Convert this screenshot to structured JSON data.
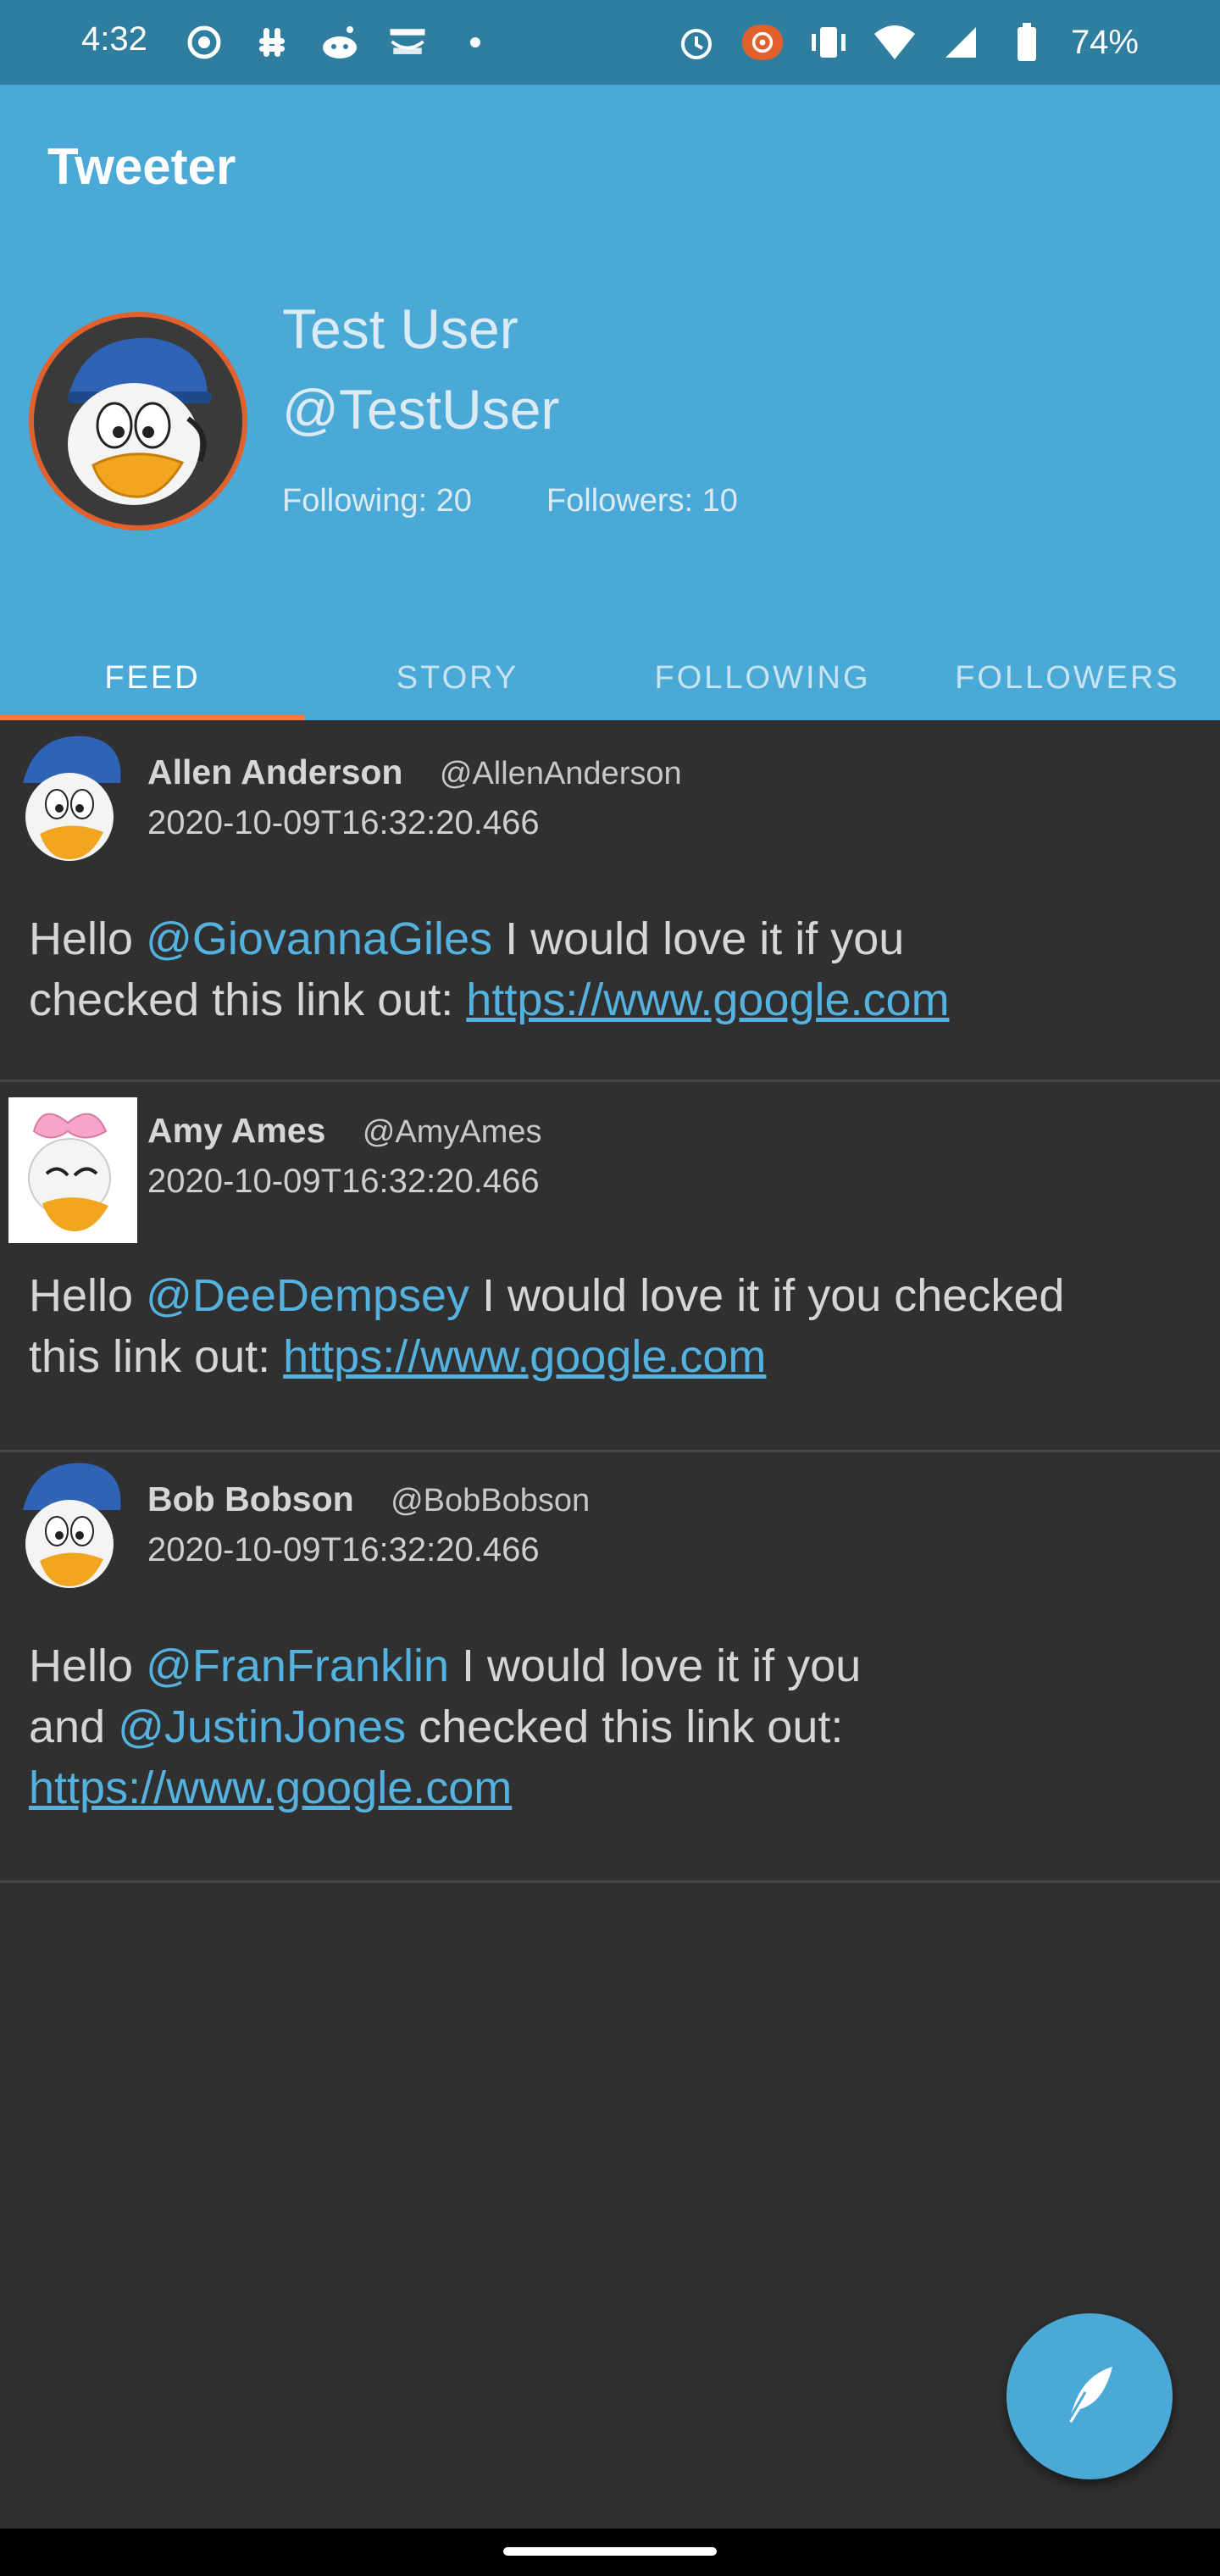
{
  "status_bar": {
    "time": "4:32",
    "battery": "74%",
    "left_icons": [
      "record-icon",
      "slack-icon",
      "reddit-icon",
      "amazon-icon",
      "dot-icon"
    ],
    "right_icons": [
      "alarm-icon",
      "cast-icon",
      "vibrate-icon",
      "wifi-icon",
      "signal-icon",
      "battery-icon"
    ]
  },
  "app": {
    "title": "Tweeter",
    "accent_color": "#4aa9d6",
    "tab_indicator_color": "#f07a4c"
  },
  "profile": {
    "name": "Test User",
    "handle": "@TestUser",
    "following": "Following: 20",
    "followers": "Followers: 10"
  },
  "tabs": [
    {
      "label": "FEED",
      "active": true
    },
    {
      "label": "STORY",
      "active": false
    },
    {
      "label": "FOLLOWING",
      "active": false
    },
    {
      "label": "FOLLOWERS",
      "active": false
    }
  ],
  "posts": [
    {
      "name": "Allen Anderson",
      "handle": "@AllenAnderson",
      "timestamp": "2020-10-09T16:32:20.466",
      "body": {
        "t1": "Hello ",
        "m1": "@GiovannaGiles",
        "t2": " I would love it if you",
        "t3": "checked this link out: ",
        "link": "https://www.google.com"
      }
    },
    {
      "name": "Amy Ames",
      "handle": "@AmyAmes",
      "timestamp": "2020-10-09T16:32:20.466",
      "body": {
        "t1": "Hello ",
        "m1": "@DeeDempsey",
        "t2": " I would love it if you checked",
        "t3": "this link out: ",
        "link": "https://www.google.com"
      }
    },
    {
      "name": "Bob Bobson",
      "handle": "@BobBobson",
      "timestamp": "2020-10-09T16:32:20.466",
      "body": {
        "t1": "Hello ",
        "m1": "@FranFranklin",
        "t2": " I would love it if you",
        "t3": "and ",
        "m2": "@JustinJones",
        "t4": " checked this link out:",
        "link": "https://www.google.com"
      }
    }
  ],
  "fab": {
    "icon": "feather-icon"
  }
}
